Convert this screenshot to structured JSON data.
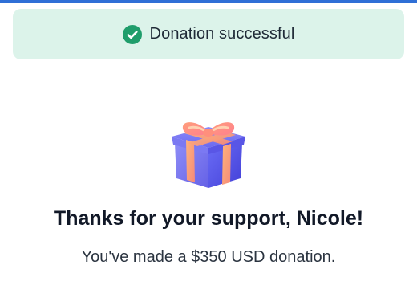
{
  "toast": {
    "message": "Donation successful",
    "icon": "check-circle-icon",
    "color_bg": "#dcf3ea",
    "color_icon": "#1f9d6b"
  },
  "illustration": {
    "icon": "gift-icon"
  },
  "content": {
    "title": "Thanks for your support, Nicole!",
    "subtitle": "You've made a $350 USD donation."
  },
  "colors": {
    "accent_bar": "#2f6fd6"
  }
}
